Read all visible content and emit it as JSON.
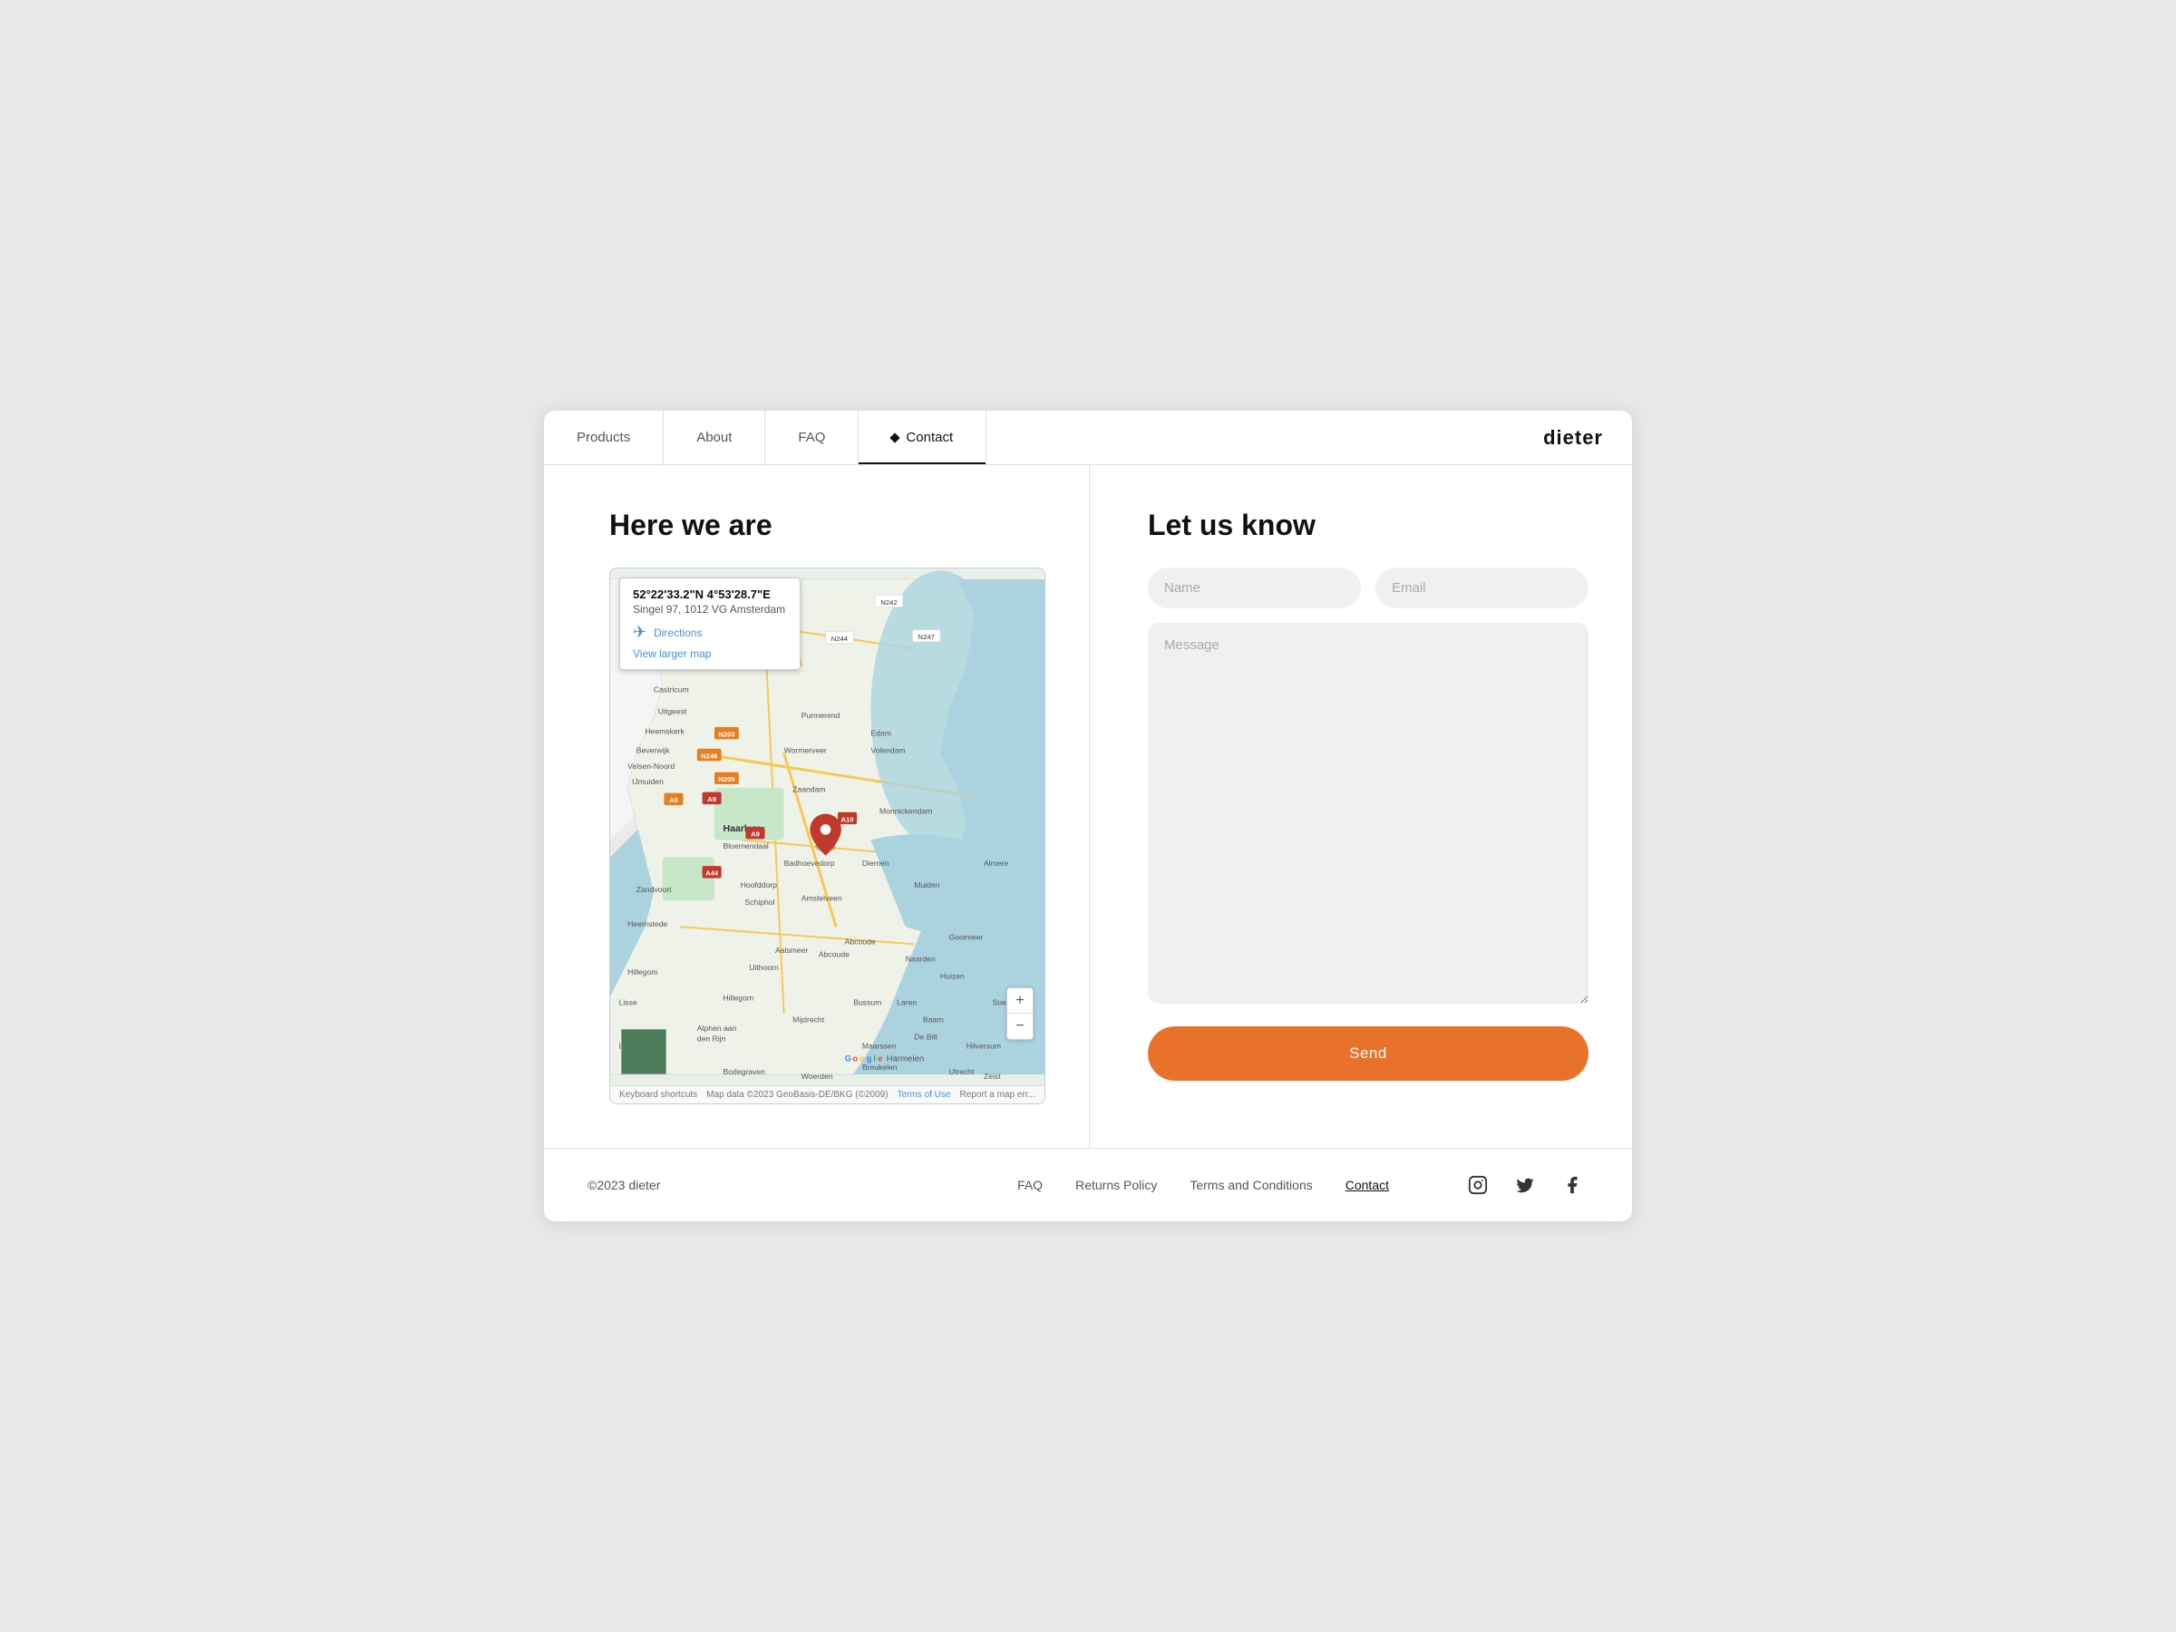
{
  "nav": {
    "items": [
      {
        "label": "Products",
        "active": false,
        "id": "products"
      },
      {
        "label": "About",
        "active": false,
        "id": "about"
      },
      {
        "label": "FAQ",
        "active": false,
        "id": "faq"
      },
      {
        "label": "Contact",
        "active": true,
        "id": "contact",
        "diamond": true
      }
    ],
    "brand": "dieter"
  },
  "left": {
    "title": "Here we are",
    "map": {
      "coords": "52°22'33.2\"N 4°53'28.7\"E",
      "address": "Singel 97, 1012 VG Amsterdam",
      "directions_label": "Directions",
      "view_larger_label": "View larger map"
    },
    "map_footer": {
      "keyboard": "Keyboard shortcuts",
      "data": "Map data ©2023 GeoBasis-DE/BKG (©2009)",
      "terms": "Terms of Use",
      "report": "Report a map err..."
    }
  },
  "right": {
    "title": "Let us know",
    "form": {
      "name_placeholder": "Name",
      "email_placeholder": "Email",
      "message_placeholder": "Message",
      "send_label": "Send"
    }
  },
  "footer": {
    "copyright": "©2023 dieter",
    "links": [
      {
        "label": "FAQ",
        "id": "faq-footer"
      },
      {
        "label": "Returns Policy",
        "id": "returns"
      },
      {
        "label": "Terms and Conditions",
        "id": "terms"
      },
      {
        "label": "Contact",
        "id": "contact-footer",
        "active": true
      }
    ],
    "socials": [
      {
        "name": "instagram-icon",
        "glyph": "&#9634;"
      },
      {
        "name": "twitter-icon",
        "glyph": "&#120143;"
      },
      {
        "name": "facebook-icon",
        "glyph": "f"
      }
    ]
  }
}
